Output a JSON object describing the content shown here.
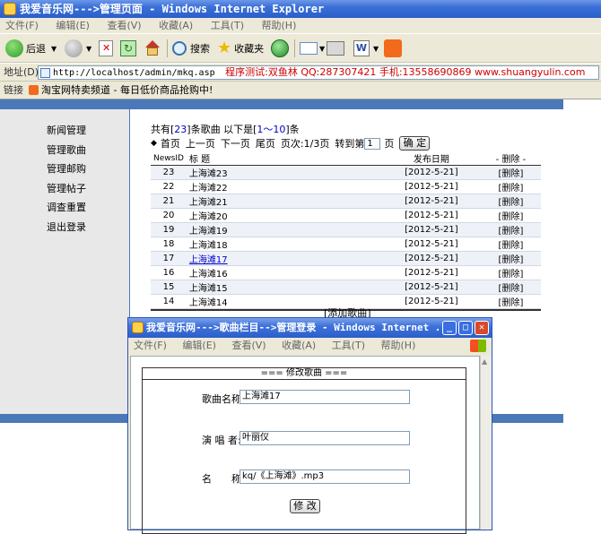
{
  "browser": {
    "title": "我爱音乐网--->管理页面 - Windows Internet Explorer",
    "menu": [
      "文件(F)",
      "编辑(E)",
      "查看(V)",
      "收藏(A)",
      "工具(T)",
      "帮助(H)"
    ],
    "back_label": "后退",
    "search_label": "搜索",
    "favorites_label": "收藏夹",
    "address_label": "地址(D)",
    "address_value": "http://localhost/admin/mkq.asp",
    "address_promo": "程序测试:双鱼林 QQ:287307421 手机:13558690869 www.shuangyulin.com",
    "links_label": "链接",
    "links_item": "淘宝网特卖频道 - 每日低价商品抢购中!"
  },
  "sidebar": {
    "items": [
      "新闻管理",
      "管理歌曲",
      "管理邮购",
      "管理帖子",
      "调查重置",
      "退出登录"
    ]
  },
  "main": {
    "summary": {
      "prefix": "共有[",
      "total": "23",
      "mid": "]条歌曲 以下是[",
      "range": "1～10",
      "suffix": "]条"
    },
    "pager": {
      "first": "首页",
      "prev": "上一页",
      "next": "下一页",
      "last": "尾页",
      "pages": "页次:1/3页",
      "goto": "转到第",
      "page_value": "1",
      "page_unit": "页",
      "confirm": "确 定"
    },
    "table": {
      "headers": [
        "NewsID",
        "标 题",
        "发布日期",
        "- 删除 -"
      ],
      "rows": [
        {
          "id": "23",
          "title": "上海滩23",
          "date": "[2012-5-21]",
          "del": "[删除]"
        },
        {
          "id": "22",
          "title": "上海滩22",
          "date": "[2012-5-21]",
          "del": "[删除]"
        },
        {
          "id": "21",
          "title": "上海滩21",
          "date": "[2012-5-21]",
          "del": "[删除]"
        },
        {
          "id": "20",
          "title": "上海滩20",
          "date": "[2012-5-21]",
          "del": "[删除]"
        },
        {
          "id": "19",
          "title": "上海滩19",
          "date": "[2012-5-21]",
          "del": "[删除]"
        },
        {
          "id": "18",
          "title": "上海滩18",
          "date": "[2012-5-21]",
          "del": "[删除]"
        },
        {
          "id": "17",
          "title": "上海滩17",
          "date": "[2012-5-21]",
          "del": "[删除]"
        },
        {
          "id": "16",
          "title": "上海滩16",
          "date": "[2012-5-21]",
          "del": "[删除]"
        },
        {
          "id": "15",
          "title": "上海滩15",
          "date": "[2012-5-21]",
          "del": "[删除]"
        },
        {
          "id": "14",
          "title": "上海滩14",
          "date": "[2012-5-21]",
          "del": "[删除]"
        }
      ]
    },
    "add_song": "[添加歌曲]"
  },
  "popup": {
    "title": "我爱音乐网--->歌曲栏目-->管理登录 - Windows Internet ...",
    "menu": [
      "文件(F)",
      "编辑(E)",
      "查看(V)",
      "收藏(A)",
      "工具(T)",
      "帮助(H)"
    ],
    "form_title": "=== 修改歌曲 ===",
    "song_name_label": "歌曲名称:",
    "song_name_value": "上海滩17",
    "singer_label": "演 唱 者:",
    "singer_value": "叶丽仪",
    "file_label": "名　　称:",
    "file_value": "kq/《上海滩》.mp3",
    "submit": "修 改"
  },
  "colors": {
    "accent_blue": "#4a78b8",
    "link_blue": "#0000cc",
    "promo_red": "#cc0000",
    "titlebar": "#2b5ec9"
  }
}
